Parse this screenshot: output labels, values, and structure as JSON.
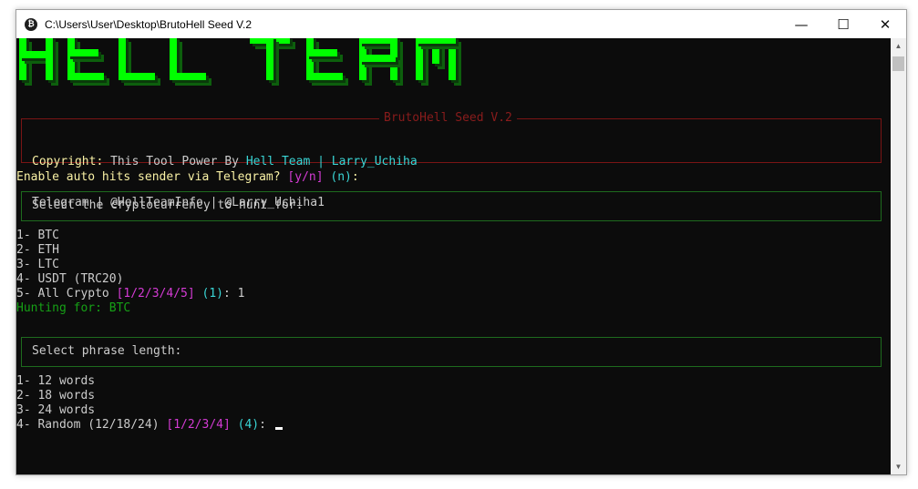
{
  "window": {
    "title": "C:\\Users\\User\\Desktop\\BrutoHell Seed V.2",
    "icon": "bitcoin-icon",
    "buttons": {
      "minimize": "—",
      "maximize": "☐",
      "close": "✕"
    }
  },
  "banner": {
    "text": "HELL TEAM",
    "color": "#00ff00"
  },
  "header_box": {
    "legend": "BrutoHell Seed V.2",
    "copyright_label": "Copyright:",
    "copyright_text": " This Tool Power By ",
    "team": "Hell Team",
    "sep": " | ",
    "author": "Larry_Uchiha",
    "telegram_line": "Telegram | @HellTeamInfo | @Larry_Uchiha1"
  },
  "prompt_telegram": {
    "text": "Enable auto hits sender via Telegram? ",
    "options": "[y/n]",
    "default": "(n)",
    "suffix": ":"
  },
  "crypto_box": {
    "title": "Select the cryptocurrency to hunt for:"
  },
  "crypto_list": [
    "1- BTC",
    "2- ETH",
    "3- LTC",
    "4- USDT (TRC20)"
  ],
  "crypto_last": {
    "text": "5- All Crypto ",
    "options": "[1/2/3/4/5]",
    "default": "(1)",
    "suffix": ": ",
    "answer": "1"
  },
  "hunting": "Hunting for: BTC",
  "phrase_box": {
    "title": "Select phrase length:"
  },
  "phrase_list": [
    "1- 12 words",
    "2- 18 words",
    "3- 24 words"
  ],
  "phrase_last": {
    "text": "4- Random (12/18/24) ",
    "options": "[1/2/3/4]",
    "default": "(4)",
    "suffix": ": "
  }
}
